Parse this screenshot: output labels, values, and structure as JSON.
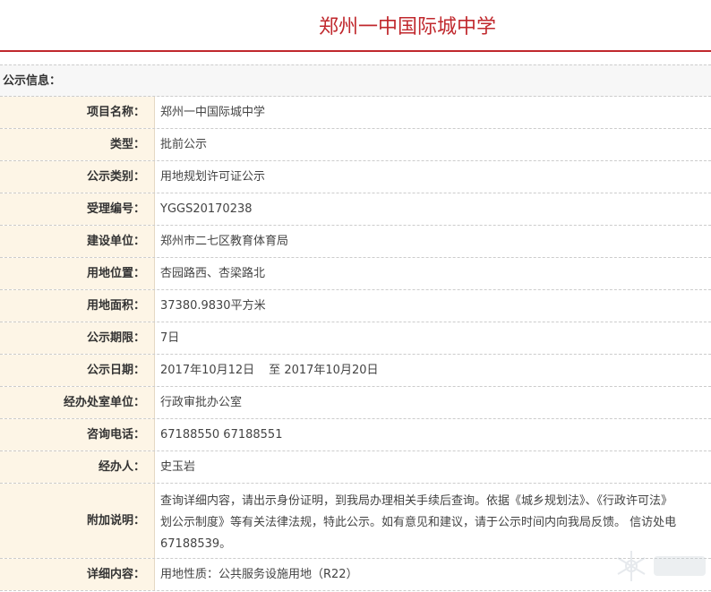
{
  "page": {
    "title": "郑州一中国际城中学"
  },
  "info_header": {
    "label": "公示信息："
  },
  "rows": [
    {
      "label": "项目名称：",
      "value": "郑州一中国际城中学"
    },
    {
      "label": "类型：",
      "value": "批前公示"
    },
    {
      "label": "公示类别：",
      "value": "用地规划许可证公示"
    },
    {
      "label": "受理编号：",
      "value": "YGGS20170238"
    },
    {
      "label": "建设单位：",
      "value": "郑州市二七区教育体育局"
    },
    {
      "label": "用地位置：",
      "value": "杏园路西、杏梁路北"
    },
    {
      "label": "用地面积：",
      "value": "37380.9830平方米"
    },
    {
      "label": "公示期限：",
      "value": "7日"
    },
    {
      "label": "公示日期：",
      "date_from": "2017年10月12日",
      "date_sep": "至",
      "date_to": "2017年10月20日"
    },
    {
      "label": "经办处室单位：",
      "value": "行政审批办公室"
    },
    {
      "label": "咨询电话：",
      "value": "67188550 67188551"
    },
    {
      "label": "经办人：",
      "value": "史玉岩"
    },
    {
      "label": "附加说明：",
      "lines": [
        "查询详细内容，请出示身份证明，到我局办理相关手续后查询。依据《城乡规划法》、《行政许可法》",
        "划公示制度》等有关法律法规，特此公示。如有意见和建议，请于公示时间内向我局反馈。 信访处电",
        "67188539。"
      ]
    },
    {
      "label": "详细内容：",
      "value": "用地性质：公共服务设施用地（R22）"
    }
  ],
  "colors": {
    "accent": "#c0282d",
    "label_bg": "#fdf5e6",
    "header_bg": "#f7f7f7"
  },
  "watermark": {
    "icon": "snowflake-logo"
  }
}
